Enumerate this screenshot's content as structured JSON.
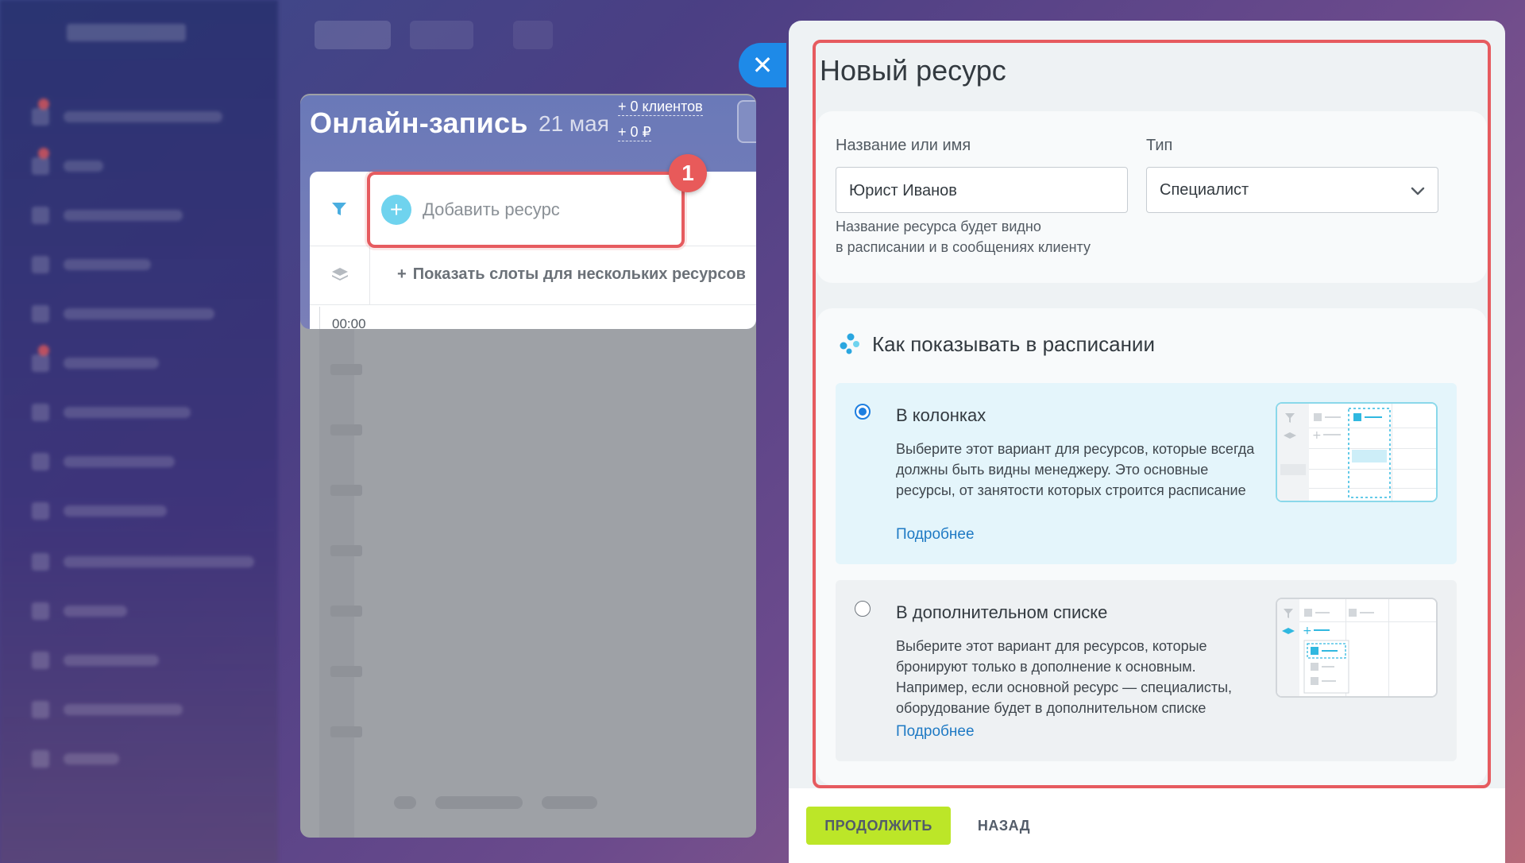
{
  "calendar": {
    "title": "Онлайн-запись",
    "date": "21 мая",
    "clients_stat": "+ 0 клиентов",
    "money_stat": "+ 0 ₽",
    "add_resource_label": "Добавить ресурс",
    "show_slots_label": "Показать слоты для нескольких ресурсов",
    "first_time": "00:00"
  },
  "step_badge": "1",
  "panel": {
    "title": "Новый ресурс",
    "name_label": "Название или имя",
    "name_value": "Юрист Иванов",
    "name_hint_line1": "Название ресурса будет видно",
    "name_hint_line2": "в расписании и в сообщениях клиенту",
    "type_label": "Тип",
    "type_value": "Специалист",
    "display_section_title": "Как показывать в расписании",
    "options": [
      {
        "title": "В колонках",
        "description": "Выберите этот вариант для ресурсов, которые всегда должны быть видны менеджеру. Это основные ресурсы, от занятости которых строится расписание",
        "link": "Подробнее",
        "selected": true
      },
      {
        "title": "В дополнительном списке",
        "description": "Выберите этот вариант для ресурсов, которые бронируют только в дополнение к основным. Например, если основной ресурс — специалисты, оборудование будет в дополнительном списке",
        "link": "Подробнее",
        "selected": false
      }
    ],
    "continue_label": "ПРОДОЛЖИТЬ",
    "back_label": "НАЗАД"
  },
  "colors": {
    "accent_blue": "#1e8ae8",
    "highlight_red": "#e65b5f",
    "continue_green": "#bce628",
    "link_blue": "#1f7ac4"
  }
}
